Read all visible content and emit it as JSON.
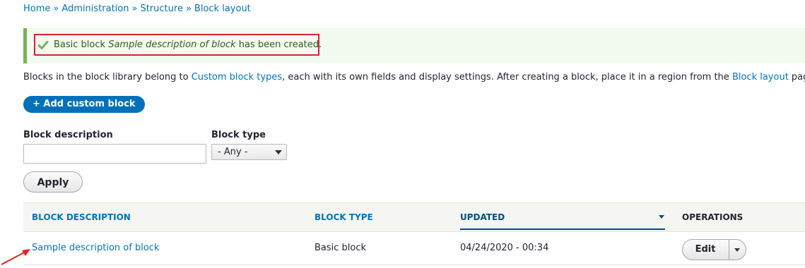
{
  "breadcrumb": {
    "items": [
      "Home",
      "Administration",
      "Structure",
      "Block layout"
    ],
    "separator": "»"
  },
  "message": {
    "prefix": "Basic block ",
    "block_name": "Sample description of block",
    "suffix": " has been created.",
    "icon": "check-icon",
    "status_color": "#77b259"
  },
  "intro": {
    "part1": "Blocks in the block library belong to ",
    "link1": "Custom block types",
    "part2": ", each with its own fields and display settings. After creating a block, place it in a region from the ",
    "link2": "Block layout",
    "part3": " page."
  },
  "add_button": {
    "label": "+ Add custom block"
  },
  "filters": {
    "description_label": "Block description",
    "description_value": "",
    "type_label": "Block type",
    "type_selected": "- Any -",
    "apply_label": "Apply"
  },
  "table": {
    "headers": {
      "description": "BLOCK DESCRIPTION",
      "type": "BLOCK TYPE",
      "updated": "UPDATED",
      "operations": "OPERATIONS"
    },
    "rows": [
      {
        "description": "Sample description of block",
        "type": "Basic block",
        "updated": "04/24/2020 - 00:34",
        "operation": "Edit"
      }
    ]
  },
  "colors": {
    "link": "#0074bd",
    "primary_button": "#0071b8",
    "highlight_box": "#d8232f"
  }
}
